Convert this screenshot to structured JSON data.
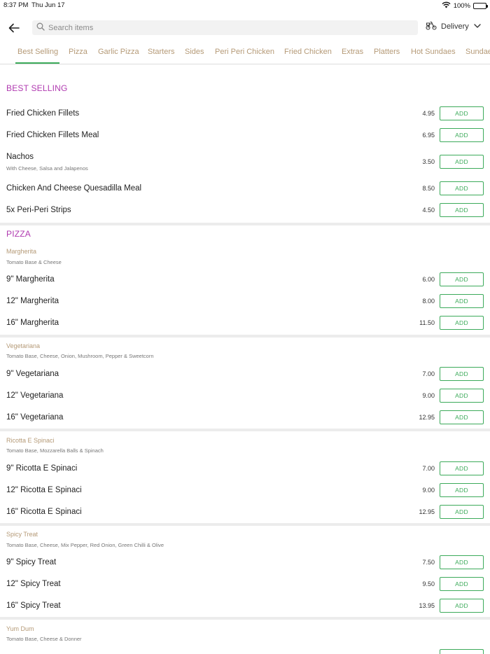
{
  "status_bar": {
    "time": "8:37 PM",
    "date": "Thu Jun 17",
    "battery": "100%"
  },
  "search": {
    "placeholder": "Search items"
  },
  "delivery": {
    "label": "Delivery"
  },
  "tabs": [
    {
      "label": "Best Selling",
      "active": true
    },
    {
      "label": "Pizza"
    },
    {
      "label": "Garlic Pizza"
    },
    {
      "label": "Starters"
    },
    {
      "label": "Sides"
    },
    {
      "label": "Peri Peri Chicken"
    },
    {
      "label": "Fried Chicken"
    },
    {
      "label": "Extras"
    },
    {
      "label": "Platters"
    },
    {
      "label": "Hot Sundaes"
    },
    {
      "label": "Sundaes"
    }
  ],
  "add_label": "ADD",
  "best_selling": {
    "title": "BEST SELLING",
    "items": [
      {
        "name": "Fried Chicken Fillets",
        "price": "4.95"
      },
      {
        "name": "Fried Chicken Fillets Meal",
        "price": "6.95"
      },
      {
        "name": "Nachos",
        "sub": "With Cheese, Salsa and Jalapenos",
        "price": "3.50"
      },
      {
        "name": "Chicken And Cheese Quesadilla Meal",
        "price": "8.50"
      },
      {
        "name": "5x Peri-Peri Strips",
        "price": "4.50"
      }
    ]
  },
  "pizza": {
    "title": "PIZZA",
    "groups": [
      {
        "title": "Margherita",
        "desc": "Tomato Base & Cheese",
        "items": [
          {
            "name": "9\" Margherita",
            "price": "6.00"
          },
          {
            "name": "12\" Margherita",
            "price": "8.00"
          },
          {
            "name": "16\" Margherita",
            "price": "11.50"
          }
        ]
      },
      {
        "title": "Vegetariana",
        "desc": "Tomato Base, Cheese, Onion, Mushroom, Pepper & Sweetcorn",
        "items": [
          {
            "name": "9\" Vegetariana",
            "price": "7.00"
          },
          {
            "name": "12\" Vegetariana",
            "price": "9.00"
          },
          {
            "name": "16\" Vegetariana",
            "price": "12.95"
          }
        ]
      },
      {
        "title": "Ricotta E Spinaci",
        "desc": "Tomato Base, Mozzarella Balls & Spinach",
        "items": [
          {
            "name": "9\" Ricotta E Spinaci",
            "price": "7.00"
          },
          {
            "name": "12\" Ricotta E Spinaci",
            "price": "9.00"
          },
          {
            "name": "16\" Ricotta E Spinaci",
            "price": "12.95"
          }
        ]
      },
      {
        "title": "Spicy Treat",
        "desc": "Tomato Base, Cheese, Mix Pepper, Red Onion, Green Chilli & Olive",
        "items": [
          {
            "name": "9\" Spicy Treat",
            "price": "7.50"
          },
          {
            "name": "12\" Spicy Treat",
            "price": "9.50"
          },
          {
            "name": "16\" Spicy Treat",
            "price": "13.95"
          }
        ]
      },
      {
        "title": "Yum Dum",
        "desc": "Tomato Base, Cheese & Donner",
        "items": []
      }
    ]
  }
}
